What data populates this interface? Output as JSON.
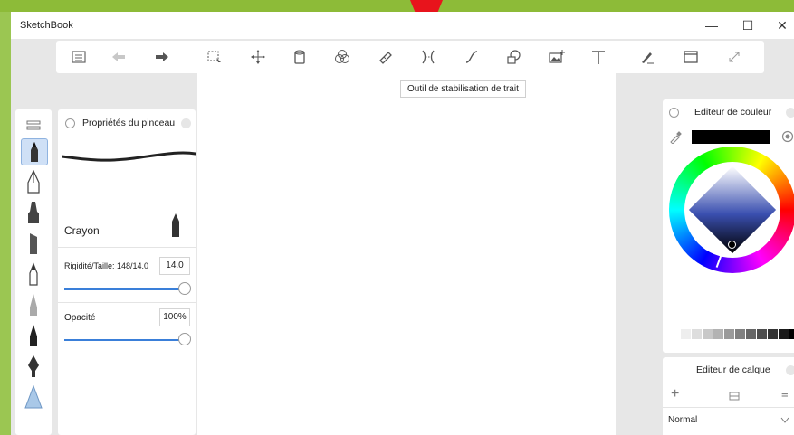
{
  "window": {
    "title": "SketchBook",
    "minimize": "—",
    "maximize": "☐",
    "close": "✕"
  },
  "tooltip": "Outil de stabilisation de trait",
  "brush_panel": {
    "title": "Propriétés du pinceau",
    "brush_name": "Crayon",
    "size_label": "Rigidité/Taille: 148/14.0",
    "size_value": "14.0",
    "opacity_label": "Opacité",
    "opacity_value": "100%",
    "size_level": 1.0,
    "opacity_level": 1.0
  },
  "color_panel": {
    "title": "Editeur de couleur",
    "current_color": "#000000"
  },
  "layer_panel": {
    "title": "Editeur de calque",
    "blend_mode": "Normal"
  },
  "colors": {
    "accent": "#3a7fd9",
    "frame": "#8dbb38",
    "arrow": "#e8141c"
  }
}
